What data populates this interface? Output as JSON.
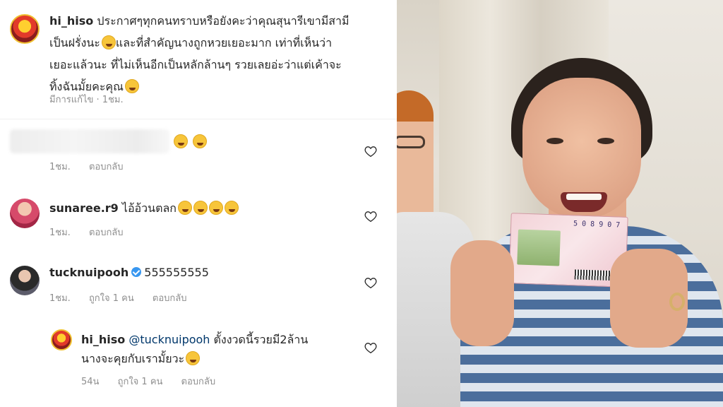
{
  "post": {
    "username": "hi_hiso",
    "caption_line1": "ประกาศๆทุกคนทราบหรือยังคะว่าคุณสุนารีเขามีสามี",
    "caption_line2": "เป็นฝรั่งนะ",
    "caption_line2b": "และที่สำคัญนางถูกหวยเยอะมาก เท่าที่เห็นว่า",
    "caption_line3": "เยอะแล้วนะ ที่ไม่เห็นอีกเป็นหลักล้านๆ รวยเลยอ่ะว่าแต่เค้าจะ",
    "caption_line4": "ทิ้งฉันมั้ยคะคุณ",
    "edited": "มีการแก้ไข · 1ชม."
  },
  "comments": [
    {
      "username": "",
      "text": "",
      "time": "1ชม.",
      "reply": "ตอบกลับ",
      "likes": ""
    },
    {
      "username": "sunaree.r9",
      "text": "ไอ้อ้วนตลก",
      "time": "1ชม.",
      "reply": "ตอบกลับ",
      "likes": ""
    },
    {
      "username": "tucknuipooh",
      "text": "555555555",
      "time": "1ชม.",
      "likes": "ถูกใจ 1 คน",
      "reply": "ตอบกลับ"
    },
    {
      "username": "hi_hiso",
      "mention": "@tucknuipooh",
      "text_line1": "ตั้งงวดนี้รวยมี2ล้าน",
      "text_line2": "นางจะคุยกับเรามั้ยวะ",
      "time": "54น",
      "likes": "ถูกใจ 1 คน",
      "reply": "ตอบกลับ"
    }
  ],
  "photo": {
    "ticket_number": "5 0 8 9 0 7"
  },
  "icons": {
    "heart": "heart-icon",
    "verified": "verified-badge-icon",
    "emoji": "emoji-icon"
  },
  "colors": {
    "meta_gray": "#8e8e8e",
    "verified_blue": "#3897f0",
    "mention_blue": "#00376b"
  }
}
